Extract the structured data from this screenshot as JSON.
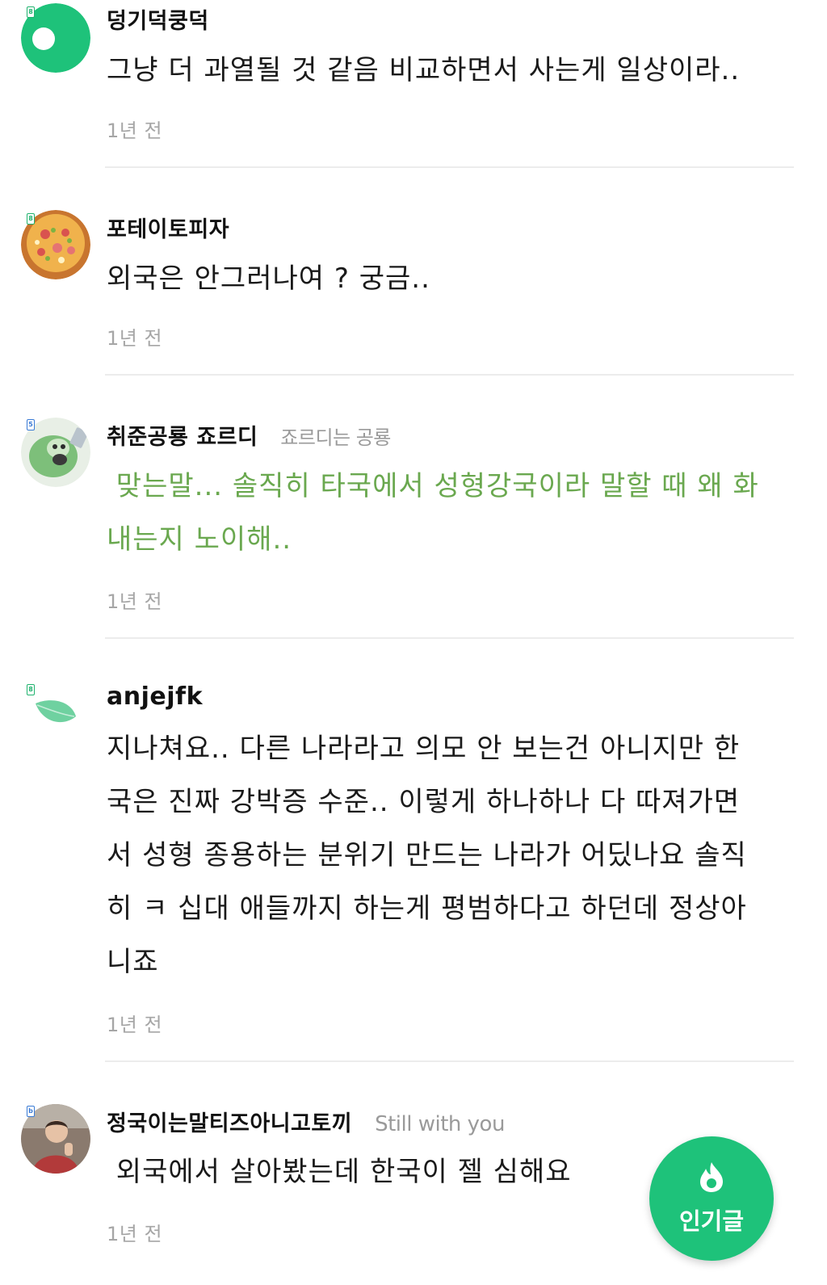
{
  "comments": [
    {
      "level": "8",
      "nickname": "덩기덕쿵덕",
      "title_tag": "",
      "lines": [
        "그냥 더 과열될 것 같음 비교하면서 사는게 일상이라.."
      ],
      "timestamp": "1년 전",
      "avatar": "green-ring-avatar"
    },
    {
      "level": "8",
      "nickname": "포테이토피자",
      "title_tag": "",
      "lines": [
        "외국은 안그러나여 ? 궁금.."
      ],
      "timestamp": "1년 전",
      "avatar": "pizza-avatar"
    },
    {
      "level": "5",
      "nickname": "취준공룡 죠르디",
      "title_tag": "죠르디는 공룡",
      "lines": [
        " 맞는말... 솔직히 타국에서 성형강국이라 말할 때 왜 화",
        "내는지 노이해.."
      ],
      "timestamp": "1년 전",
      "avatar": "jordy-avatar",
      "text_color": "#6aa84f"
    },
    {
      "level": "8",
      "nickname": "anjejfk",
      "title_tag": "",
      "lines": [
        "지나쳐요.. 다른 나라라고 의모 안 보는건 아니지만 한",
        "국은 진짜 강박증 수준.. 이렇게 하나하나 다 따져가면",
        "서 성형 종용하는 분위기 만드는 나라가 어딨나요 솔직",
        "히 ㅋ 십대 애들까지 하는게 평범하다고 하던데 정상아",
        "니죠"
      ],
      "timestamp": "1년 전",
      "avatar": "leaf-avatar"
    },
    {
      "level": "b",
      "nickname": "정국이는말티즈아니고토끼",
      "title_tag": "Still with you",
      "lines": [
        " 외국에서 살아봤는데 한국이 젤 심해요"
      ],
      "timestamp": "1년 전",
      "avatar": "child-photo-avatar"
    }
  ],
  "fab": {
    "label": "인기글",
    "icon": "fire-icon",
    "color": "#1ec27a"
  }
}
